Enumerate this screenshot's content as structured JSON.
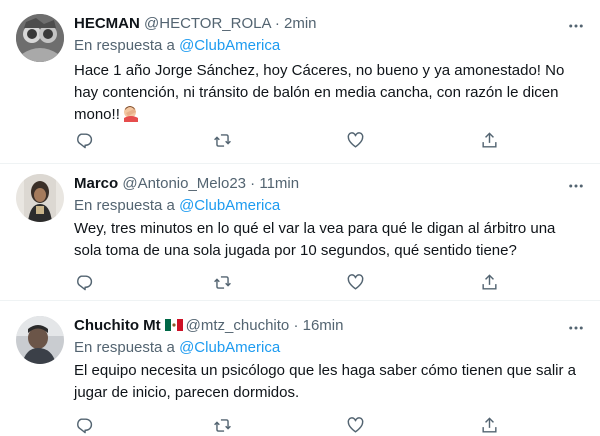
{
  "tweets": [
    {
      "display_name": "HECMAN",
      "handle": "@HECTOR_ROLA",
      "separator": "·",
      "time": "2min",
      "reply_prefix": "En respuesta a",
      "reply_to": "@ClubAmerica",
      "text": "Hace 1 año Jorge Sánchez, hoy Cáceres, no bueno y ya amonestado! No hay contención, ni tránsito de balón en media cancha, con razón le dicen mono!!",
      "emoji": "facepalm-emoji"
    },
    {
      "display_name": "Marco",
      "handle": "@Antonio_Melo23",
      "separator": "·",
      "time": "11min",
      "reply_prefix": "En respuesta a",
      "reply_to": "@ClubAmerica",
      "text": "Wey, tres minutos en lo qué el var la vea para qué le digan al árbitro una sola toma de una sola jugada por 10 segundos, qué sentido tiene?"
    },
    {
      "display_name": "Chuchito Mt",
      "flag": "mexico-flag",
      "handle": "@mtz_chuchito",
      "separator": "·",
      "time": "16min",
      "reply_prefix": "En respuesta a",
      "reply_to": "@ClubAmerica",
      "text": "El equipo necesita un psicólogo que les haga saber cómo tienen que salir a jugar de inicio, parecen dormidos."
    }
  ],
  "icons": {
    "more": "more-icon",
    "reply": "reply-icon",
    "retweet": "retweet-icon",
    "like": "like-icon",
    "share": "share-icon"
  },
  "colors": {
    "link": "#1d9bf0",
    "secondary_text": "#536471",
    "primary_text": "#0f1419",
    "divider": "#eff3f4"
  }
}
